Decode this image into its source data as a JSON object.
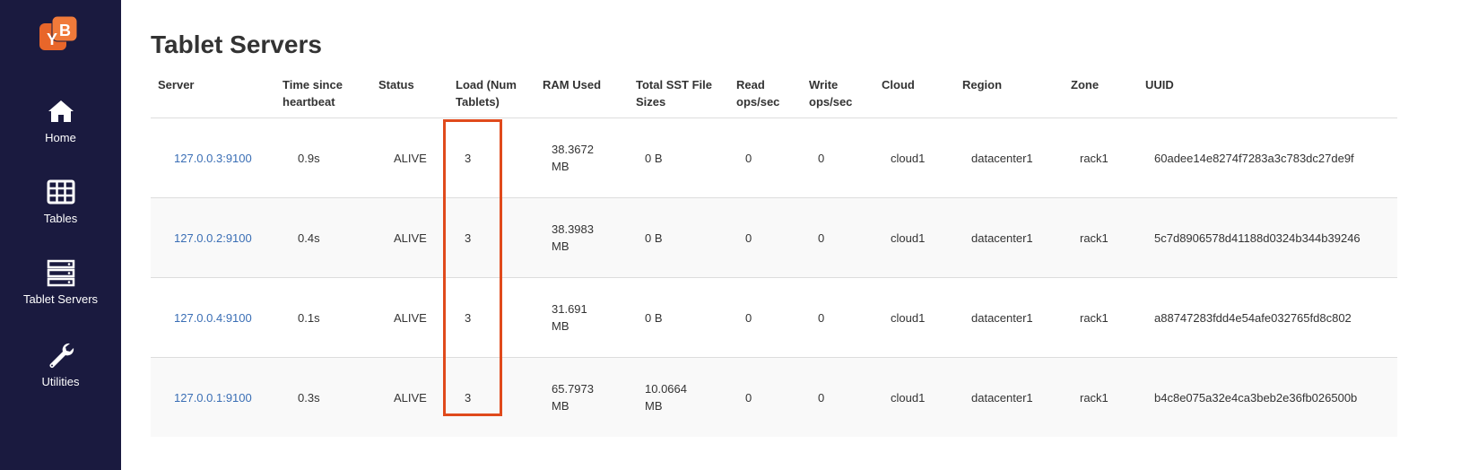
{
  "sidebar": {
    "logo_alt": "YB",
    "items": [
      {
        "label": "Home",
        "icon": "home-icon"
      },
      {
        "label": "Tables",
        "icon": "table-grid-icon"
      },
      {
        "label": "Tablet Servers",
        "icon": "server-stack-icon"
      },
      {
        "label": "Utilities",
        "icon": "wrench-icon"
      }
    ]
  },
  "page": {
    "title": "Tablet Servers"
  },
  "table": {
    "headers": {
      "server": "Server",
      "heartbeat_1": "Time since",
      "heartbeat_2": "heartbeat",
      "status": "Status",
      "load_1": "Load (Num",
      "load_2": "Tablets)",
      "ram": "RAM Used",
      "sst_1": "Total SST File",
      "sst_2": "Sizes",
      "read_1": "Read",
      "read_2": "ops/sec",
      "write_1": "Write",
      "write_2": "ops/sec",
      "cloud": "Cloud",
      "region": "Region",
      "zone": "Zone",
      "uuid": "UUID"
    },
    "rows": [
      {
        "server": "127.0.0.3:9100",
        "heartbeat": "0.9s",
        "status": "ALIVE",
        "load": "3",
        "ram_1": "38.3672",
        "ram_2": "MB",
        "sst_1": "0 B",
        "sst_2": "",
        "read": "0",
        "write": "0",
        "cloud": "cloud1",
        "region": "datacenter1",
        "zone": "rack1",
        "uuid": "60adee14e8274f7283a3c783dc27de9f"
      },
      {
        "server": "127.0.0.2:9100",
        "heartbeat": "0.4s",
        "status": "ALIVE",
        "load": "3",
        "ram_1": "38.3983",
        "ram_2": "MB",
        "sst_1": "0 B",
        "sst_2": "",
        "read": "0",
        "write": "0",
        "cloud": "cloud1",
        "region": "datacenter1",
        "zone": "rack1",
        "uuid": "5c7d8906578d41188d0324b344b39246"
      },
      {
        "server": "127.0.0.4:9100",
        "heartbeat": "0.1s",
        "status": "ALIVE",
        "load": "3",
        "ram_1": "31.691",
        "ram_2": "MB",
        "sst_1": "0 B",
        "sst_2": "",
        "read": "0",
        "write": "0",
        "cloud": "cloud1",
        "region": "datacenter1",
        "zone": "rack1",
        "uuid": "a88747283fdd4e54afe032765fd8c802"
      },
      {
        "server": "127.0.0.1:9100",
        "heartbeat": "0.3s",
        "status": "ALIVE",
        "load": "3",
        "ram_1": "65.7973",
        "ram_2": "MB",
        "sst_1": "10.0664",
        "sst_2": "MB",
        "read": "0",
        "write": "0",
        "cloud": "cloud1",
        "region": "datacenter1",
        "zone": "rack1",
        "uuid": "b4c8e075a32e4ca3beb2e36fb026500b"
      }
    ]
  },
  "colors": {
    "sidebar_bg": "#1a1a3f",
    "logo_orange": "#e8662a",
    "link_blue": "#3a6eb5",
    "alive_green": "#3c8b27",
    "highlight_red": "#e04a1c"
  }
}
